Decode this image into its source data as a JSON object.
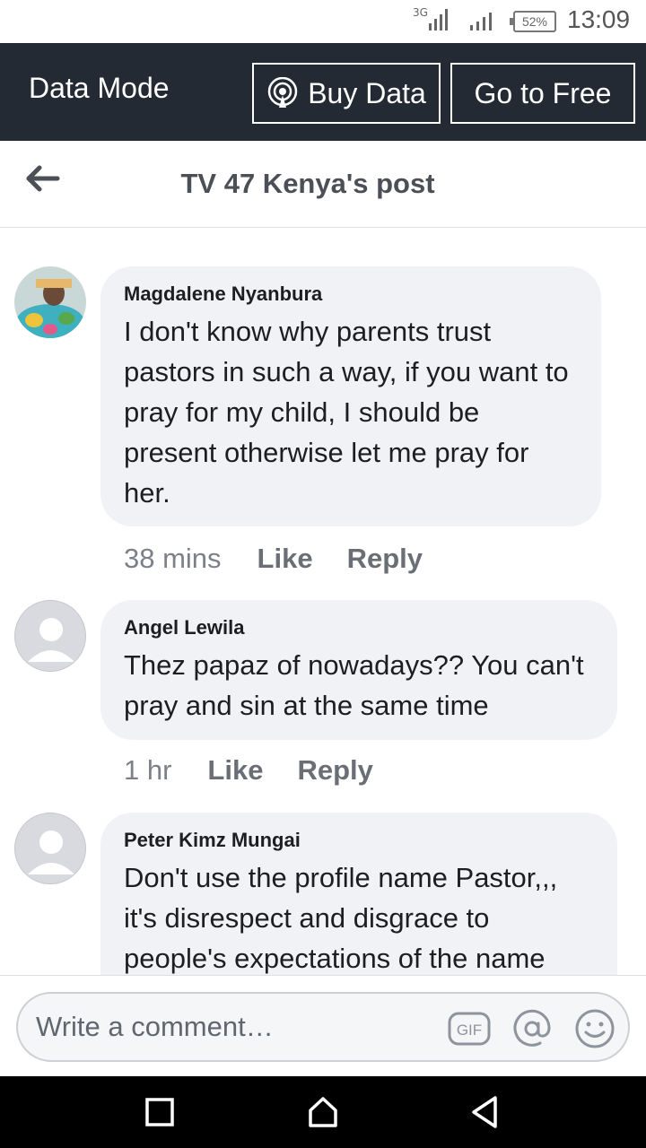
{
  "status_bar": {
    "network": "3G",
    "battery": "52%",
    "time": "13:09"
  },
  "data_bar": {
    "mode_label": "Data Mode",
    "buy_data_label": "Buy Data",
    "go_free_label": "Go to Free"
  },
  "header": {
    "title": "TV 47 Kenya's post"
  },
  "comments": [
    {
      "author": "Magdalene Nyanbura",
      "text": "I don't know why parents trust pastors in such a way, if you want to pray for my child, I should be present otherwise let me pray for her.",
      "time": "38 mins",
      "like_label": "Like",
      "reply_label": "Reply"
    },
    {
      "author": "Angel Lewila",
      "text": "Thez papaz of nowadays?? You can't pray and sin at the same time",
      "time": "1 hr",
      "like_label": "Like",
      "reply_label": "Reply"
    },
    {
      "author": "Peter Kimz Mungai",
      "text": "Don't use the profile name Pastor,,, it's disrespect and disgrace to people's expectations of the name"
    }
  ],
  "composer": {
    "placeholder": "Write a comment…",
    "gif_label": "GIF"
  },
  "colors": {
    "data_bar_bg": "#232a33",
    "bubble_bg": "#f1f2f6",
    "meta_text": "#7c8088"
  }
}
